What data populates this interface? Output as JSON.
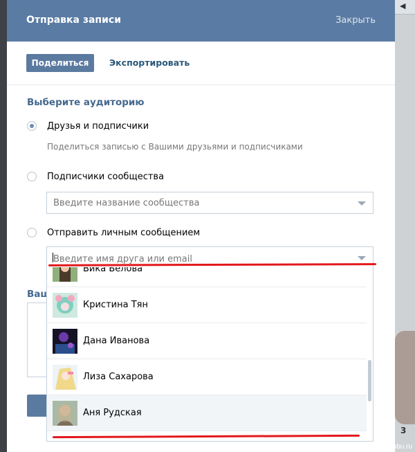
{
  "dialog": {
    "title": "Отправка записи",
    "close_label": "Закрыть"
  },
  "tabs": {
    "share_label": "Поделиться",
    "export_label": "Экспортировать"
  },
  "audience": {
    "title": "Выберите аудиторию",
    "options": [
      {
        "label": "Друзья и подписчики",
        "selected": true
      },
      {
        "label": "Подписчики сообщества",
        "selected": false
      },
      {
        "label": "Отправить личным сообщением",
        "selected": false
      }
    ],
    "friends_hint": "Поделиться записью с Вашими друзьями и подписчиками",
    "community_placeholder": "Введите название сообщества",
    "friend_placeholder": "Введите имя друга или email"
  },
  "behind": {
    "section_label_partial": "Ваш"
  },
  "friend_list": [
    {
      "name": "Вика Белова",
      "avatar": "avatar-green-girl"
    },
    {
      "name": "Кристина Тян",
      "avatar": "avatar-anime-pink"
    },
    {
      "name": "Дана Иванова",
      "avatar": "avatar-dark-purple"
    },
    {
      "name": "Лиза Сахарова",
      "avatar": "avatar-anime-blonde"
    },
    {
      "name": "Аня Рудская",
      "avatar": "avatar-photo-girl"
    }
  ],
  "background": {
    "watermark": "pikabu.ru",
    "partial_number": "3"
  },
  "colors": {
    "header": "#5a7ba3",
    "accent_text": "#45688e",
    "button": "#5b7aa0",
    "annotation": "#e2181c"
  }
}
